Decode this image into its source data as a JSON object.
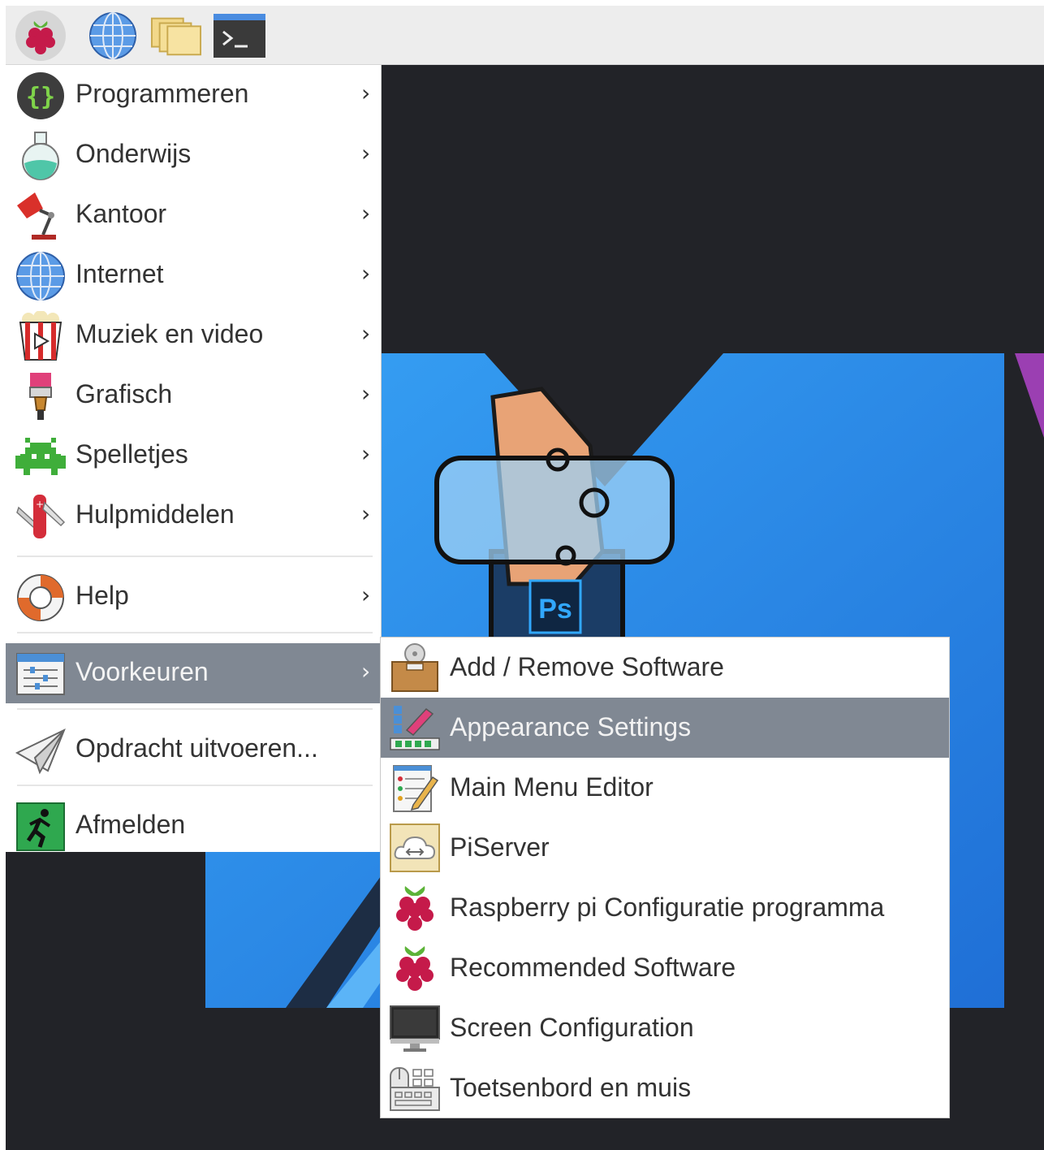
{
  "taskbar": {
    "buttons": [
      {
        "icon": "raspberry-icon"
      },
      {
        "icon": "globe-icon"
      },
      {
        "icon": "folder-icon"
      },
      {
        "icon": "terminal-icon"
      }
    ]
  },
  "menu": {
    "items": [
      {
        "label": "Programmeren",
        "icon": "braces-icon"
      },
      {
        "label": "Onderwijs",
        "icon": "flask-icon"
      },
      {
        "label": "Kantoor",
        "icon": "desk-lamp-icon"
      },
      {
        "label": "Internet",
        "icon": "globe-icon"
      },
      {
        "label": "Muziek en video",
        "icon": "popcorn-icon"
      },
      {
        "label": "Grafisch",
        "icon": "paintbrush-icon"
      },
      {
        "label": "Spelletjes",
        "icon": "space-invader-icon"
      },
      {
        "label": "Hulpmiddelen",
        "icon": "pocket-knife-icon"
      },
      {
        "label": "Help",
        "icon": "lifebuoy-icon"
      },
      {
        "label": "Voorkeuren",
        "icon": "settings-sliders-icon"
      },
      {
        "label": "Opdracht uitvoeren...",
        "icon": "paper-plane-icon"
      },
      {
        "label": "Afmelden",
        "icon": "exit-running-icon"
      }
    ],
    "chevron": "›"
  },
  "submenu": {
    "items": [
      {
        "label": "Add / Remove Software",
        "icon": "package-icon"
      },
      {
        "label": "Appearance Settings",
        "icon": "appearance-icon"
      },
      {
        "label": "Main Menu Editor",
        "icon": "menu-editor-icon"
      },
      {
        "label": "PiServer",
        "icon": "piserver-icon"
      },
      {
        "label": "Raspberry pi Configuratie programma",
        "icon": "raspberry-icon"
      },
      {
        "label": "Recommended Software",
        "icon": "raspberry-icon"
      },
      {
        "label": "Screen Configuration",
        "icon": "monitor-icon"
      },
      {
        "label": "Toetsenbord en muis",
        "icon": "keyboard-mouse-icon"
      }
    ]
  },
  "wallpaper": {
    "badge": "Ps"
  },
  "colors": {
    "highlight": "#808893",
    "desktop": "#222328",
    "wallpaper_blue": "#2f8ee8"
  }
}
